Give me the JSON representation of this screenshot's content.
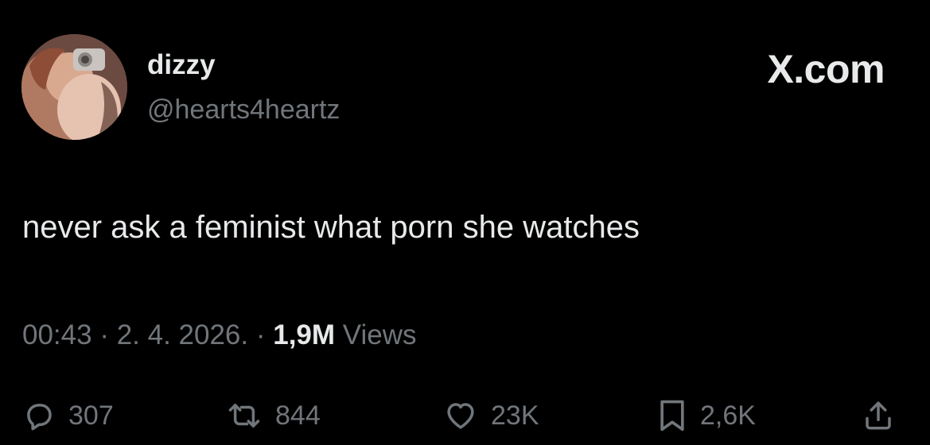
{
  "user": {
    "name": "dizzy",
    "handle": "@hearts4heartz"
  },
  "brand": "X.com",
  "tweet": {
    "text": "never ask a feminist what porn she watches"
  },
  "meta": {
    "time": "00:43",
    "sep1": " · ",
    "date": "2. 4. 2026.",
    "sep2": " · ",
    "views_count": "1,9M",
    "views_label": " Views"
  },
  "actions": {
    "replies": "307",
    "reposts": "844",
    "likes": "23K",
    "bookmarks": "2,6K"
  },
  "icons": {
    "reply": "reply-icon",
    "repost": "repost-icon",
    "like": "heart-icon",
    "bookmark": "bookmark-icon",
    "share": "share-icon"
  },
  "colors": {
    "background": "#000000",
    "primary_text": "#e7e9ea",
    "secondary_text": "#71767b"
  }
}
